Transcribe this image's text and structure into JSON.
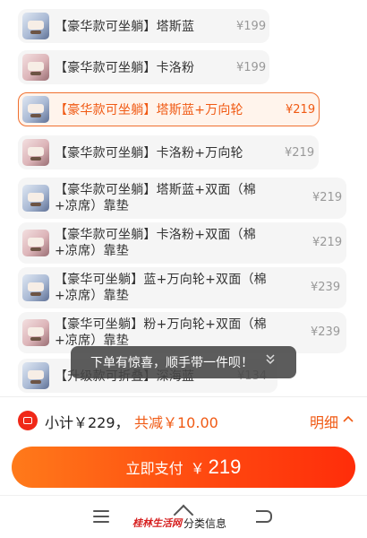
{
  "options": [
    {
      "name_line1": "【豪华款可坐躺】塔斯蓝",
      "name_line2": "",
      "price": "¥199",
      "selected": false,
      "thumb": "blue"
    },
    {
      "name_line1": "【豪华款可坐躺】卡洛粉",
      "name_line2": "",
      "price": "¥199",
      "selected": false,
      "thumb": "pink"
    },
    {
      "name_line1": "【豪华款可坐躺】塔斯蓝+万向轮",
      "name_line2": "",
      "price": "¥219",
      "selected": true,
      "thumb": "blue"
    },
    {
      "name_line1": "【豪华款可坐躺】卡洛粉+万向轮",
      "name_line2": "",
      "price": "¥219",
      "selected": false,
      "thumb": "pink"
    },
    {
      "name_line1": "【豪华款可坐躺】塔斯蓝+双面（棉",
      "name_line2": "+凉席）靠垫",
      "price": "¥219",
      "selected": false,
      "thumb": "blue"
    },
    {
      "name_line1": "【豪华款可坐躺】卡洛粉+双面（棉",
      "name_line2": "+凉席）靠垫",
      "price": "¥219",
      "selected": false,
      "thumb": "pink"
    },
    {
      "name_line1": "【豪华可坐躺】蓝+万向轮+双面（棉",
      "name_line2": "+凉席）靠垫",
      "price": "¥239",
      "selected": false,
      "thumb": "blue"
    },
    {
      "name_line1": "【豪华可坐躺】粉+万向轮+双面（棉",
      "name_line2": "+凉席）靠垫",
      "price": "¥239",
      "selected": false,
      "thumb": "pink"
    },
    {
      "name_line1": "【升级款可折叠】深海蓝",
      "name_line2": "",
      "price": "¥134",
      "selected": false,
      "thumb": "blue"
    }
  ],
  "toast": {
    "text": "下单有惊喜，顺手带一件呗！",
    "icon": "double-chevron-down-icon"
  },
  "summary": {
    "subtotal": "小计￥229，",
    "discount": "共减￥10.00",
    "detail_label": "明细",
    "detail_icon": "chevron-up-icon",
    "coupon_icon": "coupon-icon"
  },
  "pay_button": {
    "label": "立即支付",
    "currency": "￥",
    "amount": "219"
  },
  "navbar": {
    "icons": [
      "menu-icon",
      "home-icon",
      "back-icon"
    ]
  },
  "watermark": {
    "logo": "桂林生活网",
    "text": "分类信息"
  },
  "colors": {
    "accent": "#f05a14",
    "pay_gradient_start": "#ff7a1a",
    "pay_gradient_end": "#ff2d0a",
    "selected_border": "#f07030"
  }
}
